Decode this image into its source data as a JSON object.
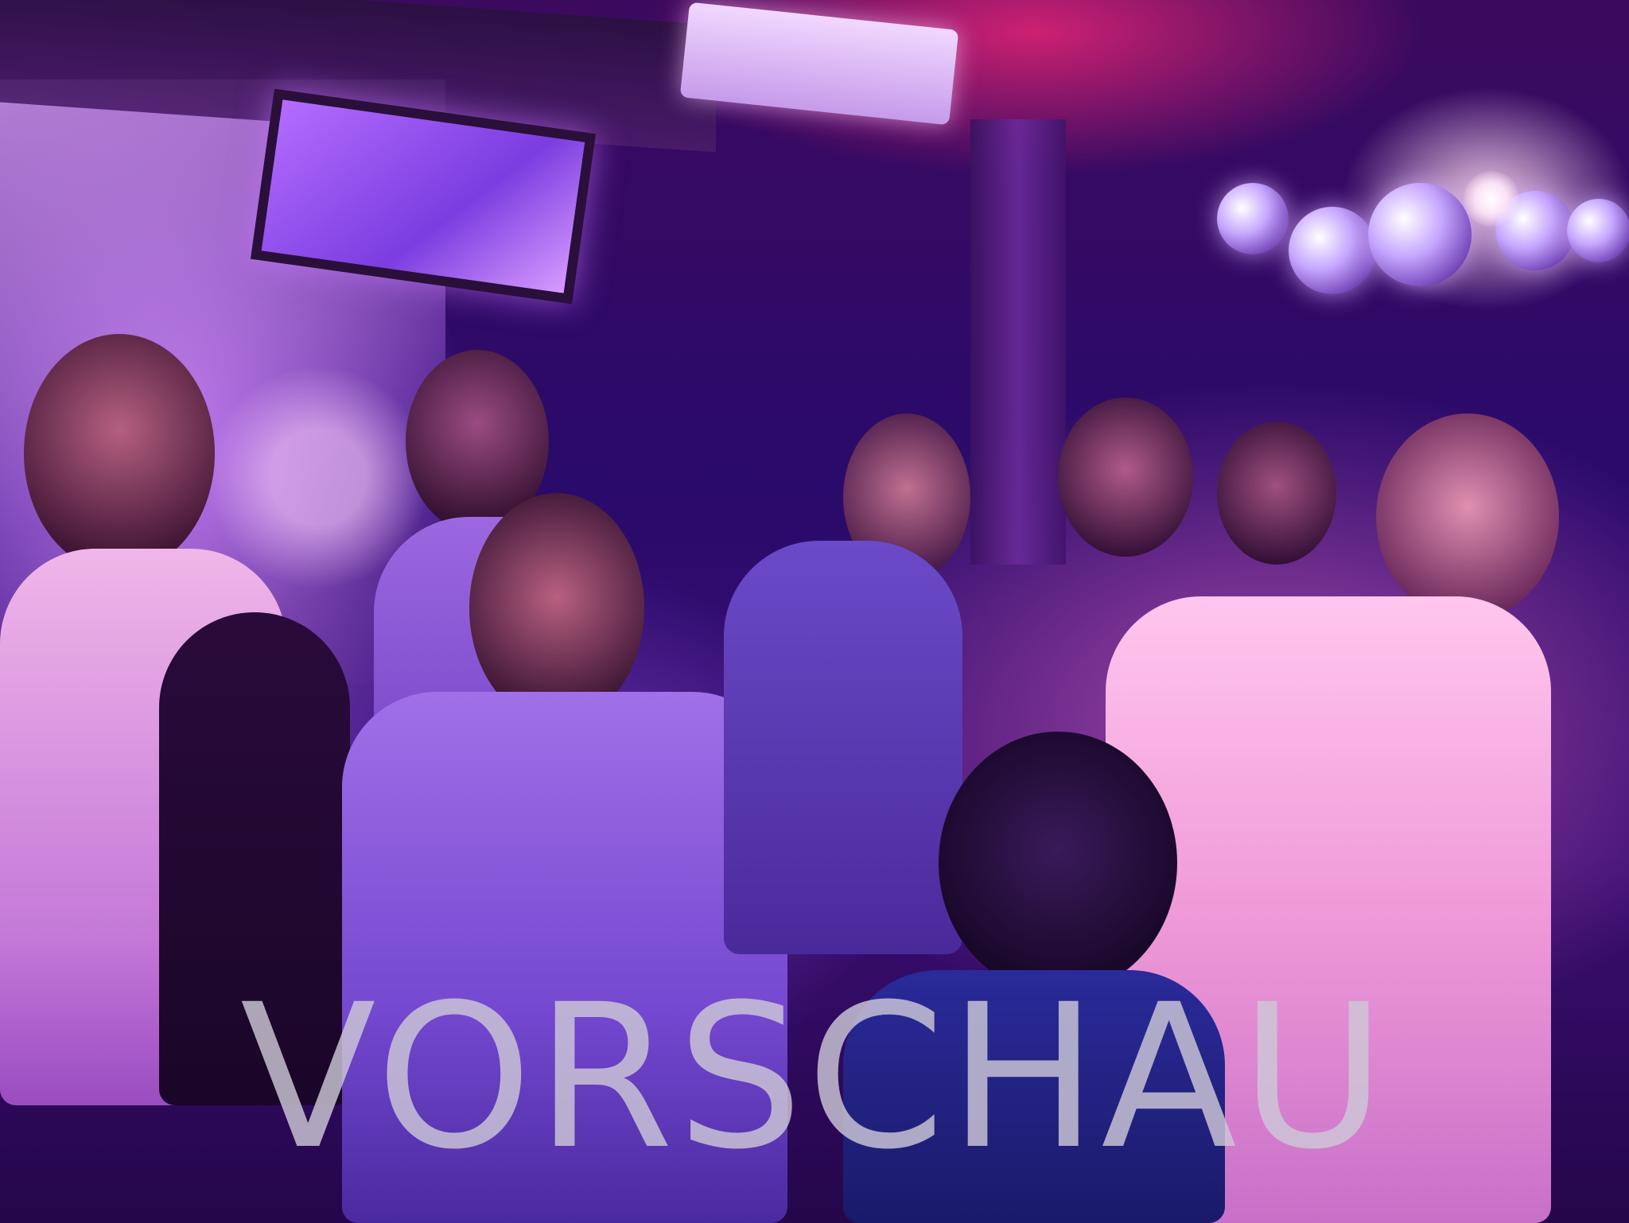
{
  "watermark": {
    "text": "VORSCHAU",
    "color": "#cdc8d7"
  },
  "scene": {
    "palette": {
      "magenta": "#ff2878",
      "violet": "#8a3de0",
      "lavender": "#e296ff",
      "deep_purple": "#2a0a6b"
    }
  }
}
